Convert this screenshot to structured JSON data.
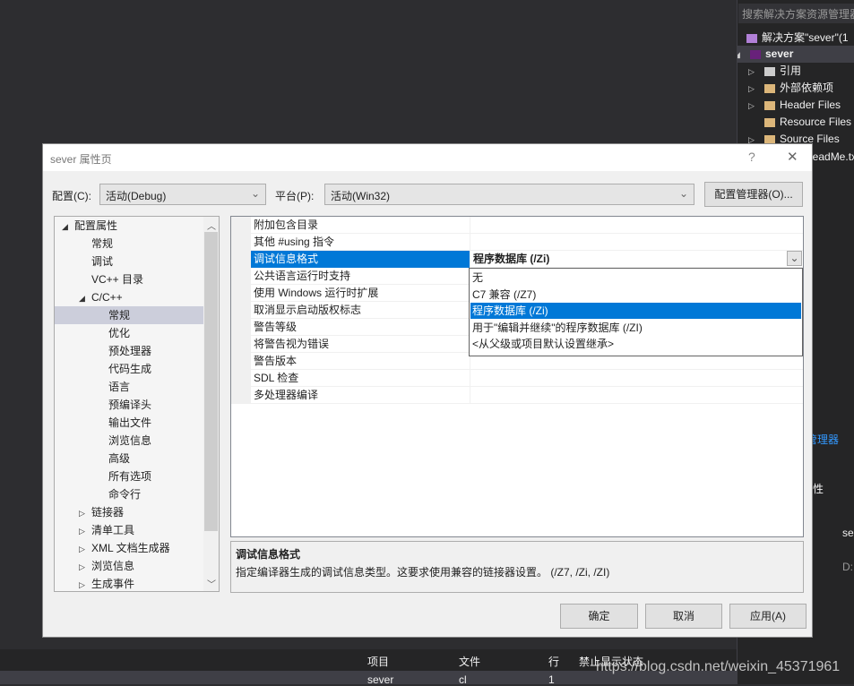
{
  "solution_explorer": {
    "search_placeholder": "搜索解决方案资源管理器",
    "items": [
      {
        "label": "解决方案\"sever\"(1",
        "icon": "solution-icon"
      },
      {
        "label": "sever",
        "icon": "project-icon"
      },
      {
        "label": "引用",
        "icon": "references-icon"
      },
      {
        "label": "外部依赖项",
        "icon": "folder-icon"
      },
      {
        "label": "Header Files",
        "icon": "folder-icon"
      },
      {
        "label": "Resource Files",
        "icon": "folder-icon"
      },
      {
        "label": "Source Files",
        "icon": "folder-icon"
      },
      {
        "label": "ReadMe.txt",
        "icon": "file-icon"
      }
    ],
    "tab_label": "管理器",
    "properties_label": "性",
    "prop_cells": [
      "se",
      "D:"
    ]
  },
  "error_list": {
    "columns": [
      "项目",
      "文件",
      "行",
      "禁止显示状态"
    ],
    "row": [
      "sever",
      "cl",
      "1"
    ],
    "watermark": "https://blog.csdn.net/weixin_45371961"
  },
  "dialog": {
    "title": "sever 属性页",
    "help": "?",
    "close": "✕",
    "config_label": "配置(C):",
    "config_value": "活动(Debug)",
    "platform_label": "平台(P):",
    "platform_value": "活动(Win32)",
    "config_manager": "配置管理器(O)...",
    "tree": [
      {
        "label": "配置属性",
        "level": 0,
        "expander": "expanded"
      },
      {
        "label": "常规",
        "level": 1
      },
      {
        "label": "调试",
        "level": 1
      },
      {
        "label": "VC++ 目录",
        "level": 1
      },
      {
        "label": "C/C++",
        "level": 1,
        "expander": "expanded"
      },
      {
        "label": "常规",
        "level": 2,
        "selected": true
      },
      {
        "label": "优化",
        "level": 2
      },
      {
        "label": "预处理器",
        "level": 2
      },
      {
        "label": "代码生成",
        "level": 2
      },
      {
        "label": "语言",
        "level": 2
      },
      {
        "label": "预编译头",
        "level": 2
      },
      {
        "label": "输出文件",
        "level": 2
      },
      {
        "label": "浏览信息",
        "level": 2
      },
      {
        "label": "高级",
        "level": 2
      },
      {
        "label": "所有选项",
        "level": 2
      },
      {
        "label": "命令行",
        "level": 2
      },
      {
        "label": "链接器",
        "level": 1,
        "expander": "collapsed"
      },
      {
        "label": "清单工具",
        "level": 1,
        "expander": "collapsed"
      },
      {
        "label": "XML 文档生成器",
        "level": 1,
        "expander": "collapsed"
      },
      {
        "label": "浏览信息",
        "level": 1,
        "expander": "collapsed"
      },
      {
        "label": "生成事件",
        "level": 1,
        "expander": "collapsed"
      }
    ],
    "properties": [
      {
        "name": "附加包含目录",
        "value": ""
      },
      {
        "name": "其他 #using 指令",
        "value": ""
      },
      {
        "name": "调试信息格式",
        "value": "程序数据库 (/Zi)",
        "selected": true
      },
      {
        "name": "公共语言运行时支持",
        "value": ""
      },
      {
        "name": "使用 Windows 运行时扩展",
        "value": ""
      },
      {
        "name": "取消显示启动版权标志",
        "value": ""
      },
      {
        "name": "警告等级",
        "value": ""
      },
      {
        "name": "将警告视为错误",
        "value": ""
      },
      {
        "name": "警告版本",
        "value": ""
      },
      {
        "name": "SDL 检查",
        "value": ""
      },
      {
        "name": "多处理器编译",
        "value": ""
      }
    ],
    "dropdown_options": [
      "无",
      "C7 兼容 (/Z7)",
      "程序数据库 (/Zi)",
      "用于\"编辑并继续\"的程序数据库 (/ZI)",
      "<从父级或项目默认设置继承>"
    ],
    "dropdown_selected_index": 2,
    "description_title": "调试信息格式",
    "description_text": "指定编译器生成的调试信息类型。这要求使用兼容的链接器设置。   (/Z7, /Zi, /ZI)",
    "ok": "确定",
    "cancel": "取消",
    "apply": "应用(A)"
  },
  "colors": {
    "accent": "#0078d7",
    "tree_selected": "#cccedb",
    "vs_dark": "#2d2d30"
  }
}
